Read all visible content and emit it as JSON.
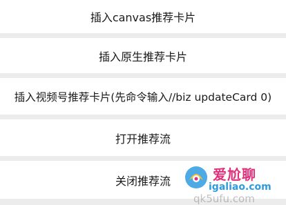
{
  "menu": {
    "items": [
      {
        "label": "插入canvas推荐卡片"
      },
      {
        "label": "插入原生推荐卡片"
      },
      {
        "label": "插入视频号推荐卡片(先命令输入//biz updateCard 0)"
      },
      {
        "label": "打开推荐流"
      },
      {
        "label": "关闭推荐流"
      }
    ]
  },
  "watermark": {
    "title": "爱尬聊",
    "url": "igaliao.com",
    "ghost_text": "qk5ufu.com"
  },
  "colors": {
    "background": "#ececec",
    "item_background": "#ffffff",
    "text": "#1a1a1a",
    "watermark_pink": "#e0307a",
    "watermark_blue": "#2e9be0"
  }
}
